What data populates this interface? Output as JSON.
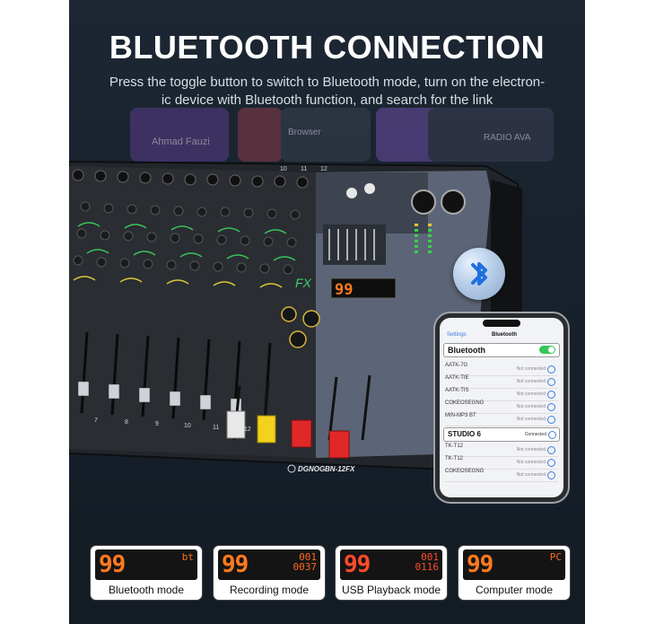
{
  "header": {
    "title": "BLUETOOTH CONNECTION",
    "subtitle_line1": "Press the toggle button to switch to Bluetooth mode, turn on the electron-",
    "subtitle_line2": "ic device with Bluetooth function, and search for the link"
  },
  "background_cards": {
    "artist": "Ahmad Fauzi",
    "browser": "Browser",
    "radio": "RADIO AVA"
  },
  "mixer": {
    "brand": "DGNOG",
    "model": "BN-12FX",
    "fx_label": "FX",
    "display_value": "99",
    "channel_numbers": [
      "7",
      "8",
      "9",
      "10",
      "11",
      "12"
    ],
    "top_channel_numbers": [
      "10",
      "11",
      "12"
    ]
  },
  "phone": {
    "nav_back": "Settings",
    "nav_title": "Bluetooth",
    "bluetooth_label": "Bluetooth",
    "devices": [
      {
        "name": "AATK-7G",
        "status": "Not connected"
      },
      {
        "name": "AATK-TIE",
        "status": "Not connected"
      },
      {
        "name": "AATK-TIS",
        "status": "Not connected"
      },
      {
        "name": "COKEOSEGNG",
        "status": "Not connected"
      },
      {
        "name": "MIN-MP3 BT",
        "status": "Not connected"
      }
    ],
    "connected_device": {
      "name": "STUDIO 6",
      "status": "Connected"
    },
    "devices_after": [
      {
        "name": "TK-T12",
        "status": "Not connected"
      },
      {
        "name": "TK-T12",
        "status": "Not connected"
      },
      {
        "name": "COKEOSEGNG",
        "status": "Not connected"
      }
    ]
  },
  "modes": [
    {
      "label": "Bluetooth mode",
      "display_big": "99",
      "display_small": "bt"
    },
    {
      "label": "Recording mode",
      "display_big": "99",
      "display_small": "001 0037"
    },
    {
      "label": "USB Playback mode",
      "display_big": "99",
      "display_small": "001 0116"
    },
    {
      "label": "Computer mode",
      "display_big": "99",
      "display_small": "PC"
    }
  ],
  "colors": {
    "panel_bg": "#18222d",
    "led_orange": "#ff7a1e",
    "fader_red": "#e02828",
    "fader_yellow": "#f2d21c",
    "phone_toggle": "#34c759",
    "bluetooth_blue": "#1e6fe0"
  }
}
